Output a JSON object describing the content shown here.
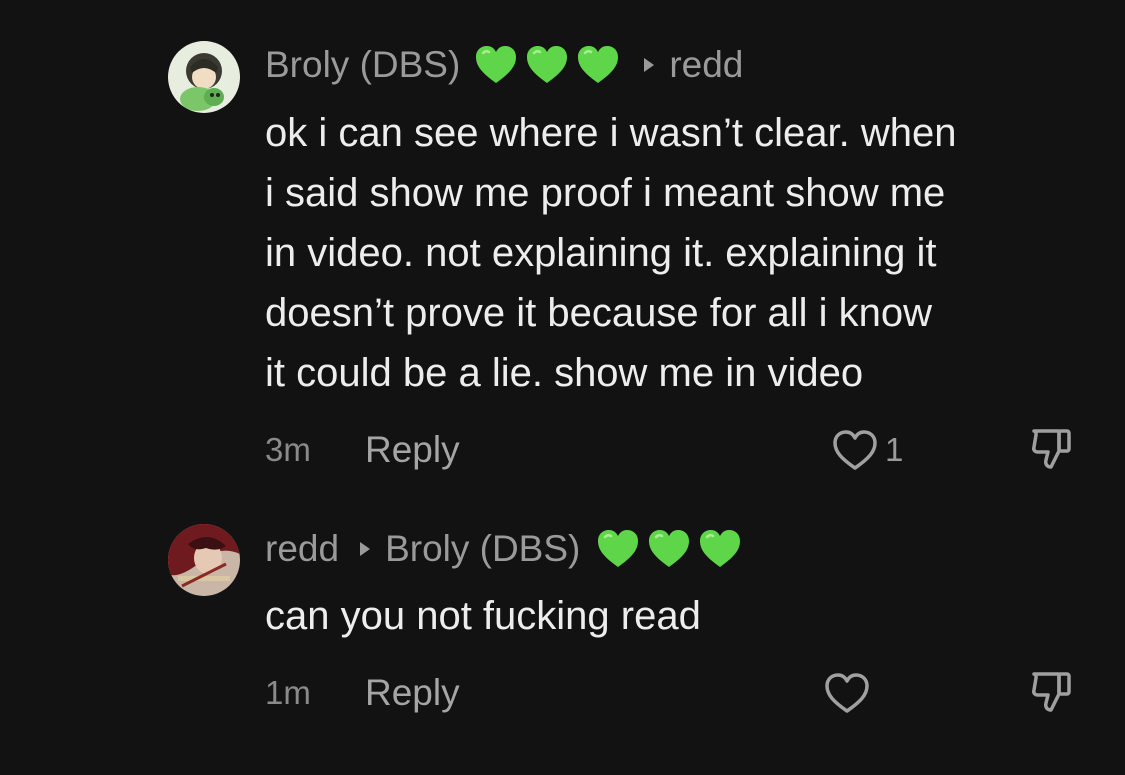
{
  "comments": [
    {
      "author": "Broly (DBS)",
      "has_hearts": true,
      "reply_to": "redd",
      "text": "ok i can see where i wasn’t clear. when\ni said show me proof i meant show me\nin video. not explaining it. explaining it\ndoesn’t prove it because for all i know\nit could be a lie. show me in video",
      "time": "3m",
      "reply_label": "Reply",
      "like_count": "1"
    },
    {
      "author": "redd",
      "reply_to": "Broly (DBS)",
      "has_hearts": true,
      "text": "can you not fucking read",
      "time": "1m",
      "reply_label": "Reply",
      "like_count": ""
    }
  ],
  "colors": {
    "background": "#121212",
    "heart_emoji": "#5fd64a",
    "text": "#ededed",
    "muted": "#9a9a9a"
  },
  "icons": {
    "heart": "heart-outline-icon",
    "dislike": "thumbs-down-icon",
    "reply_arrow": "caret-right-icon",
    "emoji": "green-heart-emoji"
  }
}
